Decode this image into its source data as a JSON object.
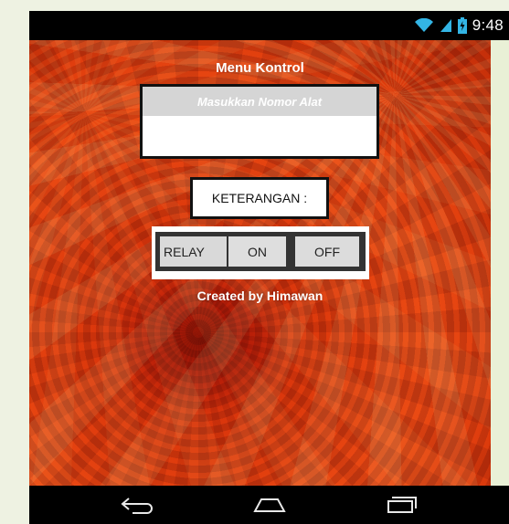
{
  "status_bar": {
    "time": "9:48",
    "icons": [
      "wifi-icon",
      "signal-icon",
      "battery-icon"
    ]
  },
  "app": {
    "title": "Menu Kontrol",
    "device_input": {
      "placeholder": "Masukkan Nomor Alat",
      "value": ""
    },
    "info_label": "KETERANGAN :",
    "relay": {
      "label": "RELAY",
      "on_label": "ON",
      "off_label": "OFF"
    },
    "credit": "Created by Himawan",
    "background": "orange-flower-image"
  },
  "nav_bar": {
    "buttons": [
      "back-icon",
      "home-icon",
      "recent-apps-icon"
    ]
  },
  "colors": {
    "status_bar_bg": "#000000",
    "frame_bg": "#eef2e2",
    "hint_bg": "#d5d5d5",
    "button_bg": "#d9d9d9"
  }
}
